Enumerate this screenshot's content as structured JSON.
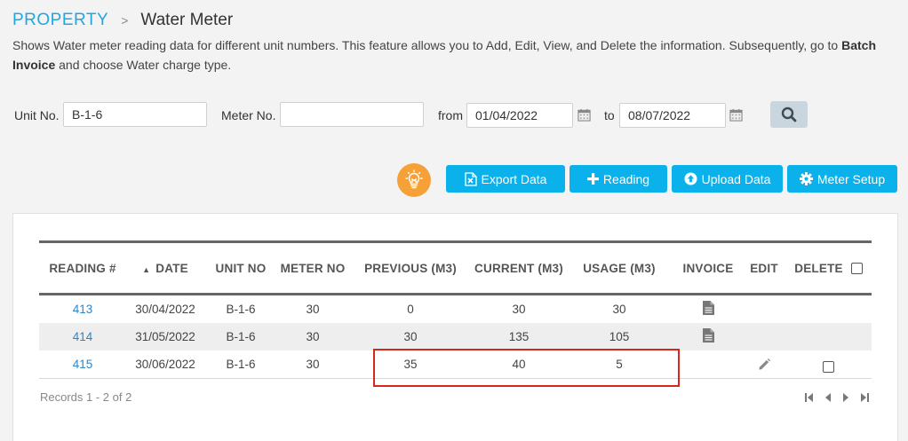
{
  "breadcrumb": {
    "root": "PROPERTY",
    "separator": ">",
    "current": "Water Meter"
  },
  "description": {
    "part1": "Shows Water meter reading data for different unit numbers. This feature allows you to Add, Edit, View, and Delete the information. Subsequently, go to ",
    "bold": "Batch Invoice",
    "part2": " and choose Water charge type."
  },
  "filters": {
    "unit_label": "Unit No.",
    "unit_value": "B-1-6",
    "meter_label": "Meter No.",
    "meter_value": "",
    "from_label": "from",
    "from_value": "01/04/2022",
    "to_label": "to",
    "to_value": "08/07/2022"
  },
  "actions": {
    "export": "Export Data",
    "reading": "Reading",
    "upload": "Upload Data",
    "meter_setup": "Meter Setup"
  },
  "table": {
    "headers": [
      "READING #",
      "DATE",
      "UNIT NO",
      "METER NO",
      "PREVIOUS (M3)",
      "CURRENT (M3)",
      "USAGE (M3)",
      "INVOICE",
      "EDIT",
      "DELETE"
    ],
    "rows": [
      {
        "reading": "413",
        "date": "30/04/2022",
        "unit": "B-1-6",
        "meter": "30",
        "previous": "0",
        "current": "30",
        "usage": "30"
      },
      {
        "reading": "414",
        "date": "31/05/2022",
        "unit": "B-1-6",
        "meter": "30",
        "previous": "30",
        "current": "135",
        "usage": "105"
      },
      {
        "reading": "415",
        "date": "30/06/2022",
        "unit": "B-1-6",
        "meter": "30",
        "previous": "35",
        "current": "40",
        "usage": "5"
      }
    ],
    "records": "Records 1 - 2 of 2"
  },
  "colors": {
    "accent": "#0ab1ea",
    "brand": "#1fa7e0",
    "bulb": "#f5a138",
    "highlight": "#d9261c"
  }
}
